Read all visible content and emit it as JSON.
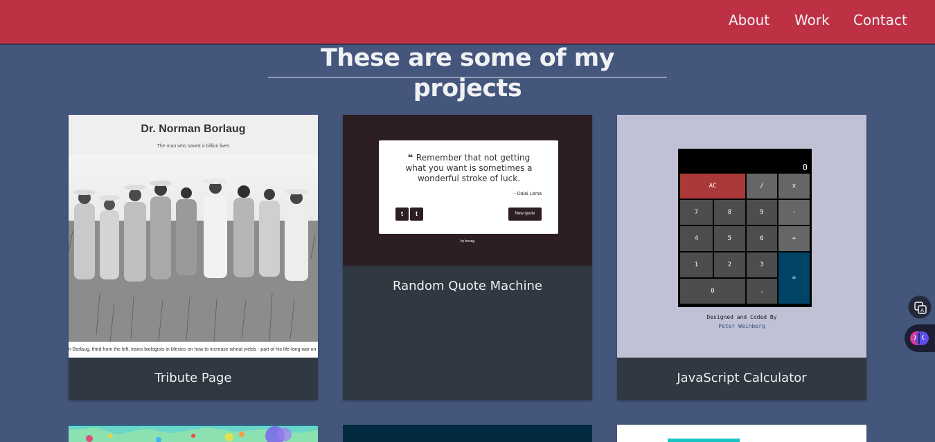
{
  "nav": {
    "items": [
      {
        "label": "About"
      },
      {
        "label": "Work"
      },
      {
        "label": "Contact"
      }
    ]
  },
  "main": {
    "heading": "These are some of my projects"
  },
  "projects": [
    {
      "title": "Tribute Page",
      "thumbnail": {
        "heading": "Dr. Norman Borlaug",
        "subheading": "The man who saved a billion lives",
        "caption": "an Borlaug, third from the left, trains biologists in Mexico on how to increase wheat yields - part of his life-long war on"
      }
    },
    {
      "title": "Random Quote Machine",
      "thumbnail": {
        "quote": "Remember that not getting what you want is sometimes a wonderful stroke of luck.",
        "author": "- Dalai Lama",
        "twitter_label": "t",
        "tumblr_label": "t",
        "new_quote_label": "New quote",
        "by_line": "by hezag"
      }
    },
    {
      "title": "JavaScript Calculator",
      "thumbnail": {
        "display": "0",
        "keys": {
          "ac": "AC",
          "divide": "/",
          "multiply": "x",
          "seven": "7",
          "eight": "8",
          "nine": "9",
          "minus": "-",
          "four": "4",
          "five": "5",
          "six": "6",
          "plus": "+",
          "one": "1",
          "two": "2",
          "three": "3",
          "equals": "=",
          "zero": "0",
          "decimal": "."
        },
        "credit_line": "Designed and Coded By",
        "credit_author": "Peter Weinberg"
      }
    }
  ],
  "colors": {
    "navbar": "#be3144",
    "background": "#45567d",
    "card": "#303841",
    "text": "#f0f1f3",
    "calc_ac": "#ac3939",
    "calc_op": "#666666",
    "calc_num": "#4d4d4d",
    "calc_equals": "#004466"
  },
  "icons": [
    "translate-icon",
    "brain-icon",
    "quote-left-icon",
    "twitter-icon",
    "tumblr-icon"
  ]
}
